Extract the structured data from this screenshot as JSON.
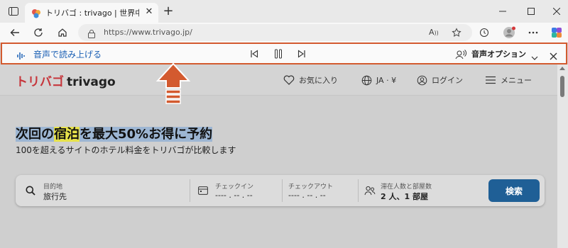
{
  "browser": {
    "tab_title": "トリバゴ : trivago | 世界中のホテル料",
    "url": "https://www.trivago.jp/"
  },
  "read_aloud": {
    "label": "音声で読み上げる",
    "voice_options": "音声オプション"
  },
  "site": {
    "logo_jp": "トリバゴ",
    "logo_en": "trivago",
    "nav": {
      "favorites": "お気に入り",
      "language": "JA · ¥",
      "login": "ログイン",
      "menu": "メニュー"
    }
  },
  "hero": {
    "title_part1": "次回の",
    "title_highlight": "宿泊",
    "title_part2": "を最大50%お得に予約",
    "subtitle": "100を超えるサイトのホテル料金をトリバゴが比較します"
  },
  "search": {
    "destination_label": "目的地",
    "destination_value": "旅行先",
    "checkin_label": "チェックイン",
    "checkin_value": "---- . -- . --",
    "checkout_label": "チェックアウト",
    "checkout_value": "---- . -- . --",
    "guests_label": "滞在人数と部屋数",
    "guests_value": "2 人、1 部屋",
    "button": "検索"
  },
  "colors": {
    "annotation_arrow": "#d35a2f",
    "search_button": "#1f5f96",
    "logo_red": "#c6363c"
  }
}
